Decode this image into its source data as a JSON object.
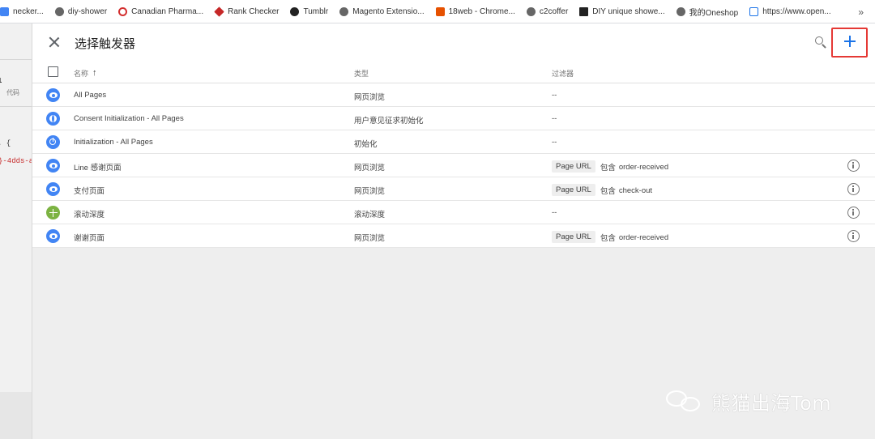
{
  "bookmarks": {
    "items": [
      {
        "label": "necker...",
        "icon": "page-icon",
        "color": "#4285f4"
      },
      {
        "label": "diy-shower",
        "icon": "globe-icon",
        "color": "#555555"
      },
      {
        "label": "Canadian Pharma...",
        "icon": "circle-icon",
        "color": "#d32f2f"
      },
      {
        "label": "Rank Checker",
        "icon": "diamond-icon",
        "color": "#c62828"
      },
      {
        "label": "Tumblr",
        "icon": "tumblr-icon",
        "color": "#222222"
      },
      {
        "label": "Magento Extensio...",
        "icon": "globe-icon",
        "color": "#555555"
      },
      {
        "label": "18web - Chrome...",
        "icon": "web-icon",
        "color": "#e65100"
      },
      {
        "label": "c2coffer",
        "icon": "globe-icon",
        "color": "#555555"
      },
      {
        "label": "DIY unique showe...",
        "icon": "d-icon",
        "color": "#222222"
      },
      {
        "label": "我的Oneshop",
        "icon": "globe-icon",
        "color": "#555555"
      },
      {
        "label": "https://www.open...",
        "icon": "link-icon",
        "color": "#1a73e8"
      }
    ],
    "more": "»"
  },
  "background": {
    "fragments": [
      "1",
      "代码",
      ". {",
      "}-4dds-a"
    ]
  },
  "panel": {
    "title": "选择触发器"
  },
  "table": {
    "headers": {
      "name": "名称",
      "sort_arrow": "↑",
      "type": "类型",
      "filter": "过滤器"
    },
    "rows": [
      {
        "name": "All Pages",
        "type": "网页浏览",
        "icon": "pageview-icon",
        "filter": "--"
      },
      {
        "name": "Consent Initialization - All Pages",
        "type": "用户意见征求初始化",
        "icon": "consent-icon",
        "filter": "--"
      },
      {
        "name": "Initialization - All Pages",
        "type": "初始化",
        "icon": "power-icon",
        "filter": "--"
      },
      {
        "name": "Line 感谢页面",
        "type": "网页浏览",
        "icon": "pageview-icon",
        "filter_variable": "Page URL",
        "filter_operator": "包含",
        "filter_value": "order-received"
      },
      {
        "name": "支付页面",
        "type": "网页浏览",
        "icon": "pageview-icon",
        "filter_variable": "Page URL",
        "filter_operator": "包含",
        "filter_value": "check-out"
      },
      {
        "name": "滚动深度",
        "type": "滚动深度",
        "icon": "scroll-icon",
        "filter": "--"
      },
      {
        "name": "谢谢页面",
        "type": "网页浏览",
        "icon": "pageview-icon",
        "filter_variable": "Page URL",
        "filter_operator": "包含",
        "filter_value": "order-received"
      }
    ]
  },
  "watermark": {
    "text": "熊猫出海Tom"
  },
  "colors": {
    "accent": "#1a73e8",
    "highlight_box": "#e53935",
    "pageview_icon": "#4285f4",
    "scroll_icon": "#7cb342"
  }
}
